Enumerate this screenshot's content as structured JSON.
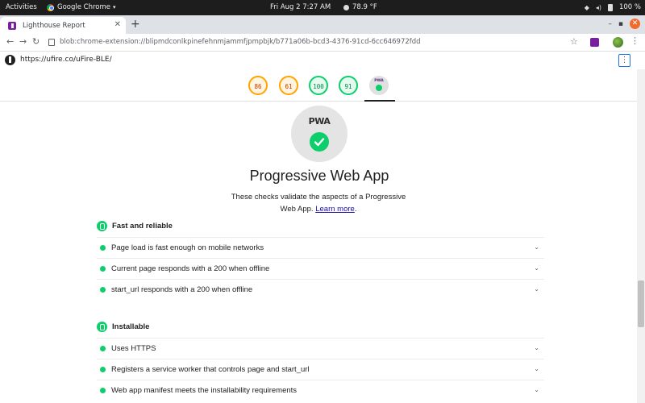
{
  "system_bar": {
    "activities": "Activities",
    "app_name": "Google Chrome",
    "clock": "Fri Aug 2   7:27 AM",
    "weather": "78.9 °F",
    "battery": "100 %"
  },
  "browser": {
    "tab_title": "Lighthouse Report",
    "address": "blob:chrome-extension://blipmdconlkpinefehnmjammfjpmpbjk/b771a06b-bcd3-4376-91cd-6cc646972fdd"
  },
  "report": {
    "url": "https://ufire.co/uFire-BLE/",
    "scores": [
      {
        "value": "86",
        "status": "average"
      },
      {
        "value": "61",
        "status": "average"
      },
      {
        "value": "100",
        "status": "pass"
      },
      {
        "value": "91",
        "status": "pass"
      }
    ],
    "pwa_badge_label": "PWA",
    "pwa_mini_label": "PWA",
    "title": "Progressive Web App",
    "description_line1": "These checks validate the aspects of a Progressive",
    "description_line2": "Web App.",
    "learn_more": "Learn more",
    "desc_period": "."
  },
  "groups": [
    {
      "title": "Fast and reliable",
      "audits": [
        "Page load is fast enough on mobile networks",
        "Current page responds with a 200 when offline",
        "start_url responds with a 200 when offline"
      ]
    },
    {
      "title": "Installable",
      "audits": [
        "Uses HTTPS",
        "Registers a service worker that controls page and start_url",
        "Web app manifest meets the installability requirements"
      ]
    }
  ],
  "colors": {
    "pass": "#0cce6b",
    "average": "#ffa400",
    "link": "#1a0dab"
  }
}
